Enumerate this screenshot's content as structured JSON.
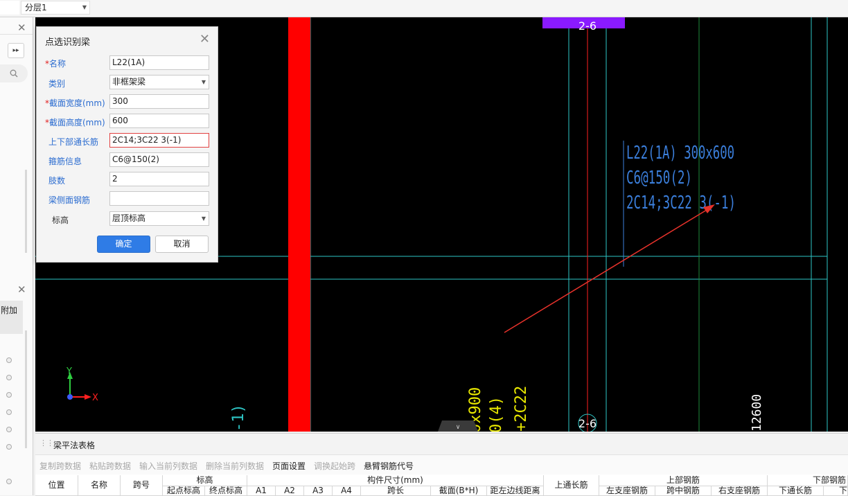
{
  "topbar": {
    "layer_value": "分层1"
  },
  "left_panel": {
    "extra_label": "附加"
  },
  "dialog": {
    "title": "点选识别梁",
    "fields": [
      {
        "label": "名称",
        "required": true,
        "value": "L22(1A)"
      },
      {
        "label": "类别",
        "required": false,
        "value": "非框架梁"
      },
      {
        "label": "截面宽度(mm)",
        "required": true,
        "value": "300"
      },
      {
        "label": "截面高度(mm)",
        "required": true,
        "value": "600"
      },
      {
        "label": "上下部通长筋",
        "required": false,
        "value": "2C14;3C22 3(-1)"
      },
      {
        "label": "箍筋信息",
        "required": false,
        "value": "C6@150(2)"
      },
      {
        "label": "肢数",
        "required": false,
        "value": "2"
      },
      {
        "label": "梁侧面钢筋",
        "required": false,
        "value": ""
      },
      {
        "label": "标高",
        "required": false,
        "value": "层顶标高"
      }
    ],
    "ok": "确定",
    "cancel": "取消"
  },
  "canvas": {
    "axis_tag_top": "2-6",
    "axis_tag_bottom": "2-6",
    "annotation": [
      "L22(1A) 300x600",
      "C6@150(2)",
      "2C14;3C22 3(-1)"
    ],
    "yellow_texts": [
      "0x900",
      "0(4)",
      "+2C22"
    ],
    "white_text": "12600",
    "cyan_text": "-1)",
    "axis_x": "X",
    "axis_y": "Y",
    "colors": {
      "column": "#ff0000",
      "grid": "#2ec7c7",
      "annotation": "#3b7fdc",
      "arrow": "#e8322b",
      "axis_tag": "#8a1aff"
    }
  },
  "bottom": {
    "title": "梁平法表格",
    "toolbar": [
      {
        "label": "复制跨数据",
        "enabled": false
      },
      {
        "label": "粘贴跨数据",
        "enabled": false
      },
      {
        "label": "输入当前列数据",
        "enabled": false
      },
      {
        "label": "删除当前列数据",
        "enabled": false
      },
      {
        "label": "页面设置",
        "enabled": true
      },
      {
        "label": "调换起始跨",
        "enabled": false
      },
      {
        "label": "悬臂钢筋代号",
        "enabled": true
      }
    ],
    "headers": {
      "position": "位置",
      "name": "名称",
      "span": "跨号",
      "elevation": "标高",
      "elev_start": "起点标高",
      "elev_end": "终点标高",
      "dims": "构件尺寸(mm)",
      "a1": "A1",
      "a2": "A2",
      "a3": "A3",
      "a4": "A4",
      "span_len": "跨长",
      "section": "截面(B*H)",
      "edge_dist": "距左边线距离",
      "top_through": "上通长筋",
      "top_rebar": "上部钢筋",
      "left_support": "左支座钢筋",
      "mid_span": "跨中钢筋",
      "right_support": "右支座钢筋",
      "bottom_rebar": "下部钢筋",
      "bottom_through": "下通长筋",
      "bottom_more": "下"
    }
  }
}
